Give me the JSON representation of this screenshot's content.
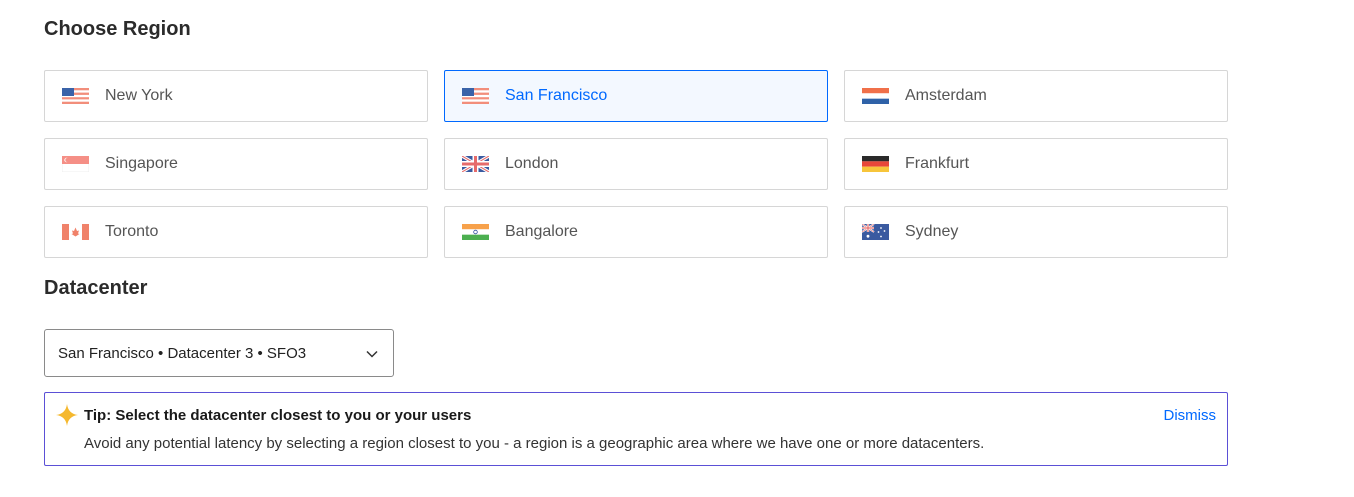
{
  "region_section": {
    "title": "Choose Region",
    "selected": "San Francisco",
    "regions": [
      {
        "label": "New York",
        "flag": "us-flag-icon"
      },
      {
        "label": "San Francisco",
        "flag": "us-flag-icon"
      },
      {
        "label": "Amsterdam",
        "flag": "netherlands-flag-icon"
      },
      {
        "label": "Singapore",
        "flag": "singapore-flag-icon"
      },
      {
        "label": "London",
        "flag": "uk-flag-icon"
      },
      {
        "label": "Frankfurt",
        "flag": "germany-flag-icon"
      },
      {
        "label": "Toronto",
        "flag": "canada-flag-icon"
      },
      {
        "label": "Bangalore",
        "flag": "india-flag-icon"
      },
      {
        "label": "Sydney",
        "flag": "australia-flag-icon"
      }
    ]
  },
  "datacenter_section": {
    "title": "Datacenter",
    "selected_value": "San Francisco • Datacenter 3 • SFO3",
    "dropdown_icon": "chevron-down-icon"
  },
  "tip": {
    "icon": "sparkle-icon",
    "title": "Tip: Select the datacenter closest to you or your users",
    "body": "Avoid any potential latency by selecting a region closest to you - a region is a geographic area where we have one or more datacenters.",
    "dismiss_label": "Dismiss"
  },
  "colors": {
    "accent": "#0069ff",
    "tip_border": "#5b50d6",
    "star": "#f5b82e"
  }
}
